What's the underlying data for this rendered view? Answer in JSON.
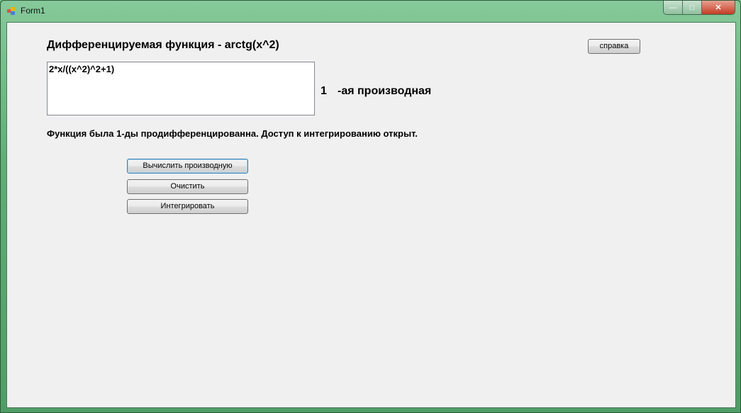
{
  "window": {
    "title": "Form1",
    "minimize": "—",
    "maximize": "□",
    "close": "✕"
  },
  "main": {
    "heading": "Дифференцируемая функция - arctg(x^2)",
    "help_button": "справка",
    "result_text": "2*x/((x^2)^2+1)",
    "order_number": "1",
    "order_label": "-ая производная",
    "status": "Функция была 1-ды продифференцированна. Доступ к интегрированию открыт.",
    "buttons": {
      "derive": "Вычислить производную",
      "clear": "Очистить",
      "integrate": "Интегрировать"
    }
  }
}
